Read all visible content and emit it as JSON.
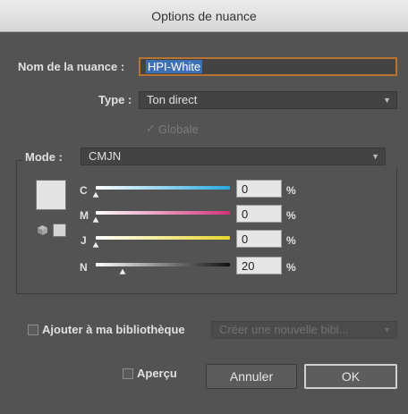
{
  "window": {
    "title": "Options de nuance"
  },
  "name": {
    "label": "Nom de la nuance :",
    "value": "HPI-White"
  },
  "type": {
    "label": "Type :",
    "value": "Ton direct"
  },
  "globale": {
    "label": "Globale",
    "checked": true,
    "enabled": false
  },
  "mode": {
    "label": "Mode :",
    "value": "CMJN"
  },
  "channels": [
    {
      "letter": "C",
      "value": "0",
      "level": 0,
      "unit": "%"
    },
    {
      "letter": "M",
      "value": "0",
      "level": 0,
      "unit": "%"
    },
    {
      "letter": "J",
      "value": "0",
      "level": 0,
      "unit": "%"
    },
    {
      "letter": "N",
      "value": "20",
      "level": 20,
      "unit": "%"
    }
  ],
  "library": {
    "label": "Ajouter à ma bibliothèque",
    "checked": false,
    "select_value": "Créer une nouvelle bibl..."
  },
  "preview": {
    "label": "Aperçu",
    "checked": false
  },
  "buttons": {
    "cancel": "Annuler",
    "ok": "OK"
  },
  "colors": {
    "accent": "#b8732e",
    "cyan": "#29a9e1",
    "magenta": "#d4317a",
    "yellow": "#e8d72a",
    "black": "#111111",
    "swatch": "#e4e4e4"
  }
}
